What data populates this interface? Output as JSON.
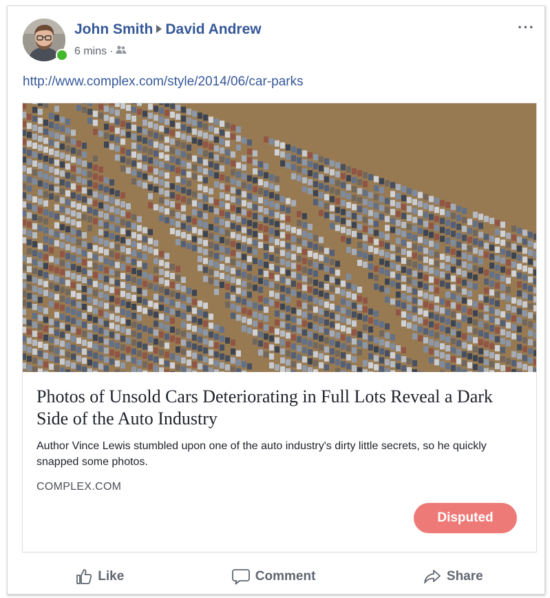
{
  "post": {
    "author": "John Smith",
    "recipient": "David Andrew",
    "time": "6 mins",
    "separator": "·",
    "audience_icon": "friends-icon",
    "more_icon": "more-options-icon",
    "more_glyph": "···",
    "link_text": "http://www.complex.com/style/2014/06/car-parks"
  },
  "attachment": {
    "image_subject": "aerial-parking-lot-photo",
    "headline": "Photos of Unsold Cars Deteriorating in Full Lots Reveal a Dark Side of the Auto Industry",
    "description": "Author Vince Lewis stumbled upon one of the auto industry's dirty little secrets, so he quickly snapped some photos.",
    "domain": "COMPLEX.COM",
    "badge_label": "Disputed"
  },
  "actions": {
    "like_label": "Like",
    "comment_label": "Comment",
    "share_label": "Share"
  },
  "colors": {
    "name_blue": "#365899",
    "online_green": "#42b72a",
    "disputed_red": "#ee7a78",
    "muted_text": "#606770"
  }
}
